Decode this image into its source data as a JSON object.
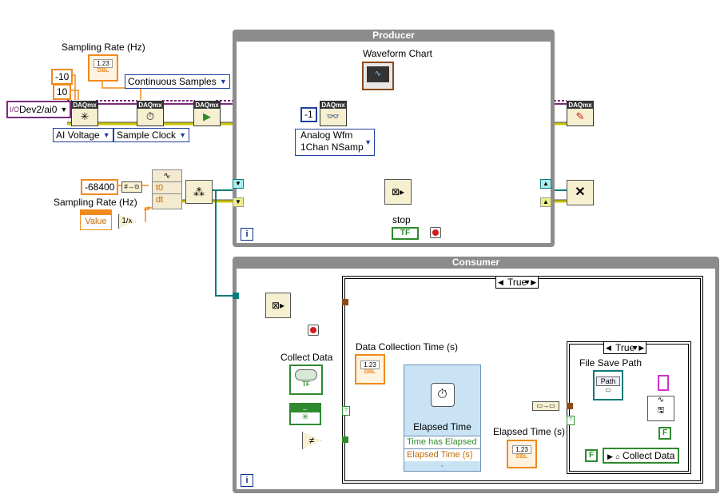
{
  "producer": {
    "title": "Producer",
    "iteration": "i"
  },
  "consumer": {
    "title": "Consumer",
    "iteration": "i"
  },
  "labels": {
    "sampling_rate_1": "Sampling Rate (Hz)",
    "sampling_rate_2": "Sampling Rate (Hz)",
    "waveform_chart": "Waveform Chart",
    "stop": "stop",
    "collect_data": "Collect Data",
    "data_collection_time": "Data Collection Time (s)",
    "elapsed_time_label": "Elapsed Time (s)",
    "file_save_path": "File Save Path"
  },
  "constants": {
    "neg10": "-10",
    "ten": "10",
    "dev": "Dev2/ai0",
    "neg1": "-1",
    "t0_val": "-68400",
    "value": "Value"
  },
  "rings": {
    "continuous": "Continuous Samples",
    "ai_voltage": "AI Voltage",
    "sample_clock": "Sample Clock",
    "analog_wfm_1": "Analog Wfm",
    "analog_wfm_2": "1Chan NSamp"
  },
  "cases": {
    "outer": "True",
    "inner": "True"
  },
  "timer": {
    "title": "Elapsed Time",
    "out1": "Time has Elapsed",
    "out2": "Elapsed Time (s)"
  },
  "badges": {
    "dbl": "DBL",
    "num": "1.23",
    "tf": "TF",
    "path": "Path",
    "f": "F",
    "daqmx": "DAQmx",
    "t0": "t0",
    "dt": "dt",
    "collect_data_local": "Collect Data"
  },
  "colors": {
    "wire_orange": "#f08a1c",
    "wire_brown": "#8a4a1a",
    "wire_purple": "#7a2a7a",
    "loop_gray": "#8c8c8c",
    "wire_yellow": "#c8c400"
  }
}
